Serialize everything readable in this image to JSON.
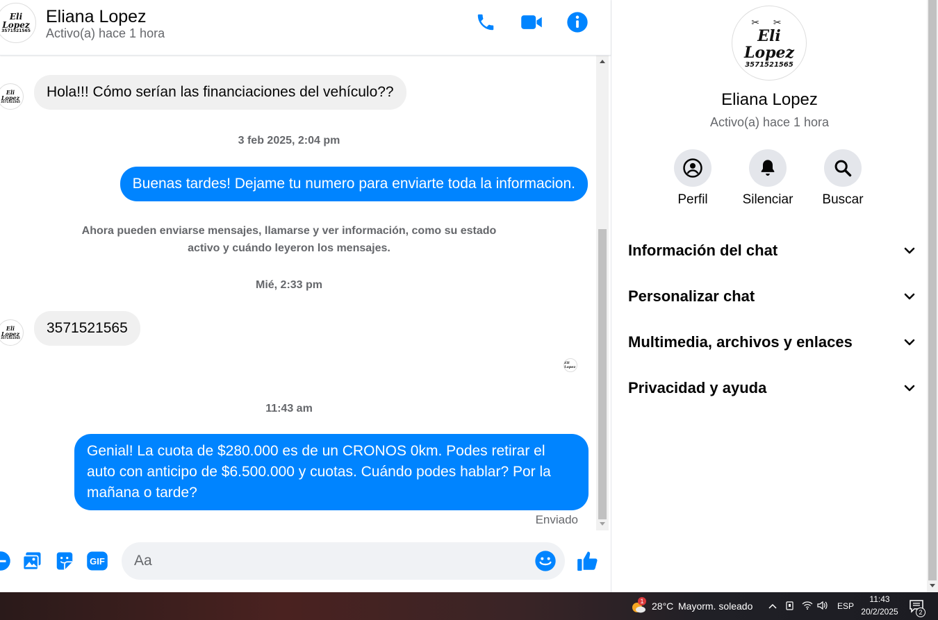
{
  "contact": {
    "name": "Eliana Lopez",
    "status": "Activo(a) hace 1 hora",
    "logo_name": "Eli Lopez",
    "logo_phone": "3571521565"
  },
  "header": {
    "call_icon": "phone-icon",
    "video_icon": "video-icon",
    "info_icon": "info-icon"
  },
  "messages": [
    {
      "type": "incoming",
      "text": "Hola!!! Cómo serían las financiaciones del vehículo??"
    },
    {
      "type": "timestamp",
      "text": "3 feb 2025, 2:04 pm"
    },
    {
      "type": "outgoing",
      "text": "Buenas tardes! Dejame tu numero para enviarte toda la informacion."
    },
    {
      "type": "system",
      "line1": "Ahora pueden enviarse mensajes, llamarse y ver información, como su estado",
      "line2": "activo y cuándo leyeron los mensajes."
    },
    {
      "type": "timestamp",
      "text": "Mié, 2:33 pm"
    },
    {
      "type": "incoming",
      "text": "3571521565"
    },
    {
      "type": "timestamp",
      "text": "11:43 am"
    },
    {
      "type": "outgoing",
      "text": "Genial! La cuota de $280.000 es de un CRONOS 0km. Podes retirar el auto con anticipo de $6.500.000 y cuotas. Cuándo podes hablar? Por la mañana o tarde?"
    }
  ],
  "sent_label": "Enviado",
  "composer": {
    "placeholder": "Aa",
    "gif_label": "GIF"
  },
  "panel": {
    "actions": [
      {
        "label": "Perfil",
        "icon": "profile-icon"
      },
      {
        "label": "Silenciar",
        "icon": "bell-icon"
      },
      {
        "label": "Buscar",
        "icon": "search-icon"
      }
    ],
    "sections": [
      "Información del chat",
      "Personalizar chat",
      "Multimedia, archivos y enlaces",
      "Privacidad y ayuda"
    ]
  },
  "taskbar": {
    "weather_badge": "1",
    "temperature": "28°C",
    "weather": "Mayorm. soleado",
    "language": "ESP",
    "time": "11:43",
    "date": "20/2/2025",
    "notifications": "2"
  },
  "colors": {
    "accent": "#0084ff",
    "incoming_bubble": "#f0f0f0",
    "secondary_text": "#65676b"
  }
}
